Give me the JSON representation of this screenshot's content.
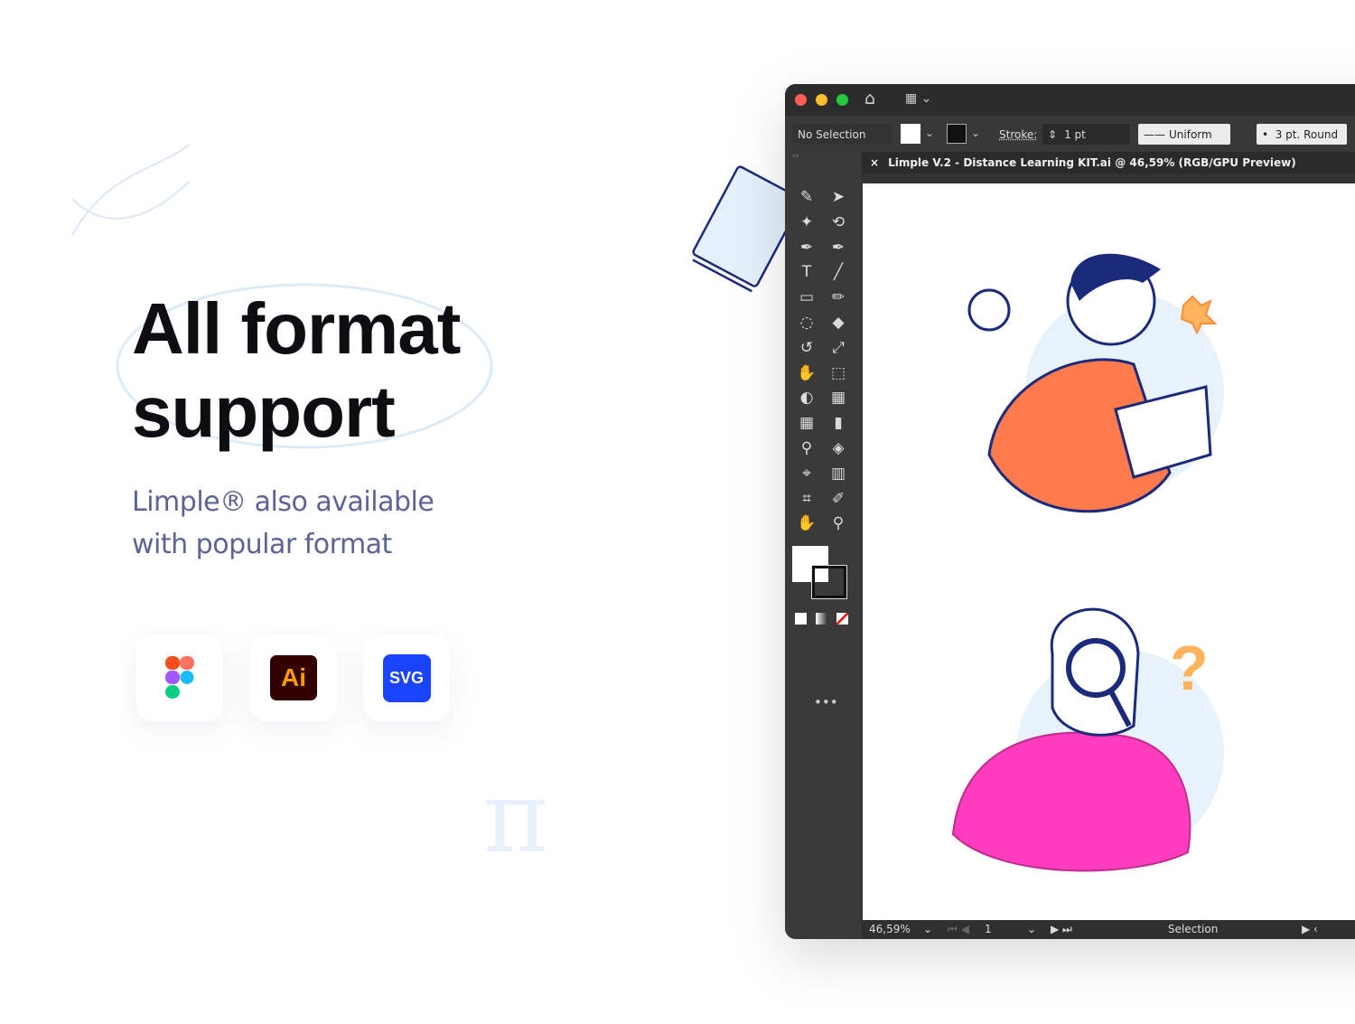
{
  "hero": {
    "title_line1": "All format",
    "title_line2": "support",
    "subtitle_line1": "Limple® also available",
    "subtitle_line2": "with popular format"
  },
  "formats": [
    {
      "name": "Figma",
      "icon": "figma-icon"
    },
    {
      "name": "Ai",
      "icon": "illustrator-icon",
      "color": "#330000",
      "text_color": "#ff9a00"
    },
    {
      "name": "SVG",
      "icon": "svg-icon",
      "color": "#1a44ff"
    }
  ],
  "app": {
    "control_bar": {
      "selection": "No Selection",
      "stroke_label": "Stroke:",
      "stroke_value": "1 pt",
      "profile": "Uniform",
      "brush": "3 pt. Round"
    },
    "document_tab": {
      "close": "×",
      "title": "Limple V.2 - Distance Learning KIT.ai @ 46,59% (RGB/GPU Preview)"
    },
    "status_bar": {
      "zoom": "46,59%",
      "artboard": "1",
      "tool": "Selection"
    },
    "tools": [
      "✎",
      "➤",
      "✦",
      "⟲",
      "✒",
      "✒",
      "T",
      "╱",
      "▭",
      "✏",
      "◌",
      "◆",
      "↺",
      "⤢",
      "✋",
      "⬚",
      "◐",
      "▦",
      "▦",
      "▮",
      "⚲",
      "◈",
      "⌖",
      "▥",
      "⌗",
      "✐",
      "✋",
      "⚲"
    ],
    "colors": {
      "accent_red": "#ff5f57",
      "accent_yellow": "#febc2e",
      "accent_green": "#28c840"
    }
  }
}
